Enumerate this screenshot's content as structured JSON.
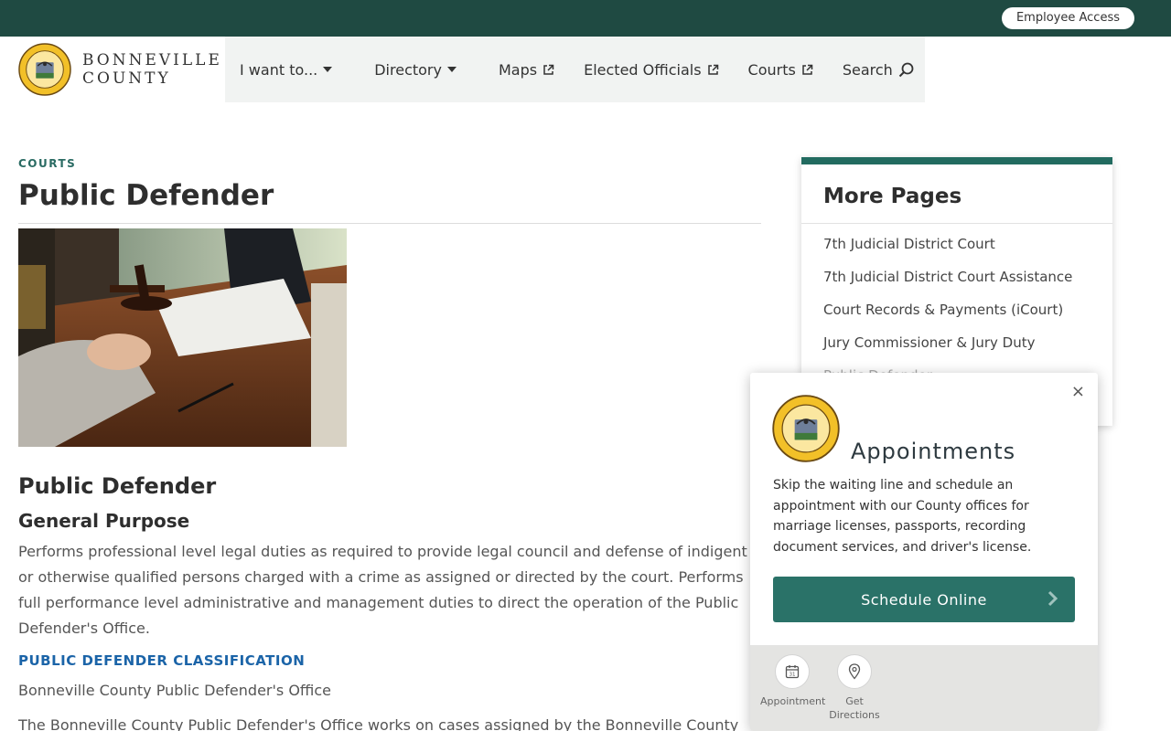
{
  "topbar": {
    "employee_access": "Employee Access"
  },
  "logo": {
    "line1": "BONNEVILLE",
    "line2": "COUNTY"
  },
  "nav": {
    "i_want_to": "I want to...",
    "directory": "Directory",
    "maps": "Maps",
    "elected_officials": "Elected Officials",
    "courts": "Courts",
    "search": "Search"
  },
  "main": {
    "eyebrow": "COURTS",
    "title": "Public Defender",
    "section_heading": "Public Defender",
    "subheading": "General Purpose",
    "paragraph": "Performs professional level legal duties as required to provide legal council and defense of indigent or otherwise qualified persons charged with a crime as assigned or directed by the court. Performs full performance level administrative and management duties to direct the operation of the Public Defender's Office.",
    "classification_link": "PUBLIC DEFENDER CLASSIFICATION",
    "office_name": "Bonneville County Public Defender's Office",
    "office_desc": "The Bonneville County Public Defender's Office works on cases assigned by the Bonneville County"
  },
  "more_pages": {
    "title": "More Pages",
    "items": [
      "7th Judicial District Court",
      "7th Judicial District Court Assistance",
      "Court Records & Payments (iCourt)",
      "Jury Commissioner & Jury Duty",
      "Public Defender"
    ]
  },
  "appointments": {
    "close": "×",
    "title": "Appointments",
    "text": "Skip the waiting line and schedule an appointment with our County offices for marriage licenses, passports, recording document services, and driver's license.",
    "button": "Schedule Online",
    "footer_appointment": "Appointment",
    "footer_directions": "Get Directions",
    "calendar_day": "31"
  },
  "colors": {
    "topbar": "#1f4a42",
    "accent": "#226b60",
    "button": "#2a7268",
    "link": "#1b64a8"
  }
}
